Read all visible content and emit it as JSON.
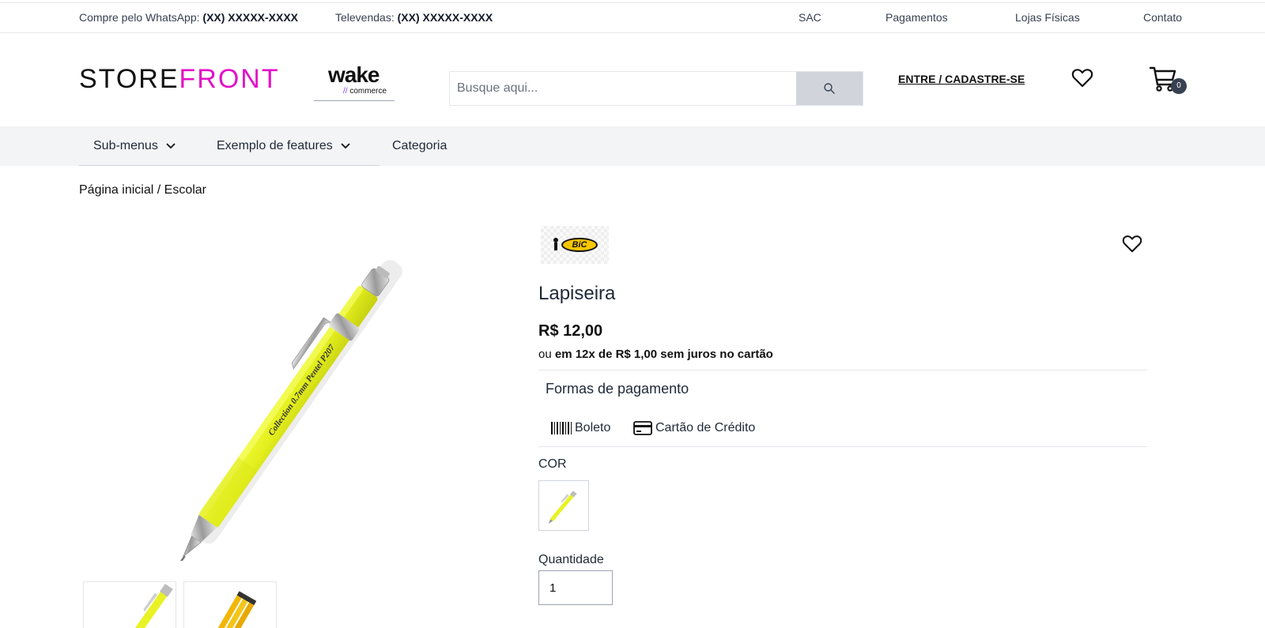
{
  "topbar": {
    "whatsapp_label": "Compre pelo WhatsApp:",
    "whatsapp_number": "(XX) XXXXX-XXXX",
    "televendas_label": "Televendas:",
    "televendas_number": "(XX) XXXXX-XXXX",
    "links": [
      "SAC",
      "Pagamentos",
      "Lojas Físicas",
      "Contato"
    ]
  },
  "header": {
    "logo_part1": "STORE",
    "logo_part2": "FRONT",
    "partner_logo_main": "wake",
    "partner_logo_slashes": "//",
    "partner_logo_sub": "commerce",
    "search_placeholder": "Busque aqui...",
    "login_label": "ENTRE / CADASTRE-SE",
    "cart_count": "0",
    "icons": [
      "search-icon",
      "heart-icon",
      "cart-icon"
    ]
  },
  "nav": {
    "items": [
      "Sub-menus",
      "Exemplo de features",
      "Categoria"
    ]
  },
  "breadcrumb": {
    "home": "Página inicial",
    "separator": "/",
    "current": "Escolar"
  },
  "product": {
    "brand_logo_text": "BiC",
    "title": "Lapiseira",
    "price": "R$ 12,00",
    "installment_prefix": "ou",
    "installment_text": "em 12x de R$ 1,00 sem juros no cartão",
    "payment_title": "Formas de pagamento",
    "payment_methods": [
      "Boleto",
      "Cartão de Crédito"
    ],
    "pen_print": "Collection 0.7mm Pentel P207",
    "color_label": "COR",
    "quantity_label": "Quantidade",
    "quantity_value": "1"
  },
  "colors": {
    "brand_magenta": "#e212c8",
    "pen_yellow": "#e8f224",
    "nav_bg": "#f3f4f6",
    "search_button": "#d1d5db"
  }
}
